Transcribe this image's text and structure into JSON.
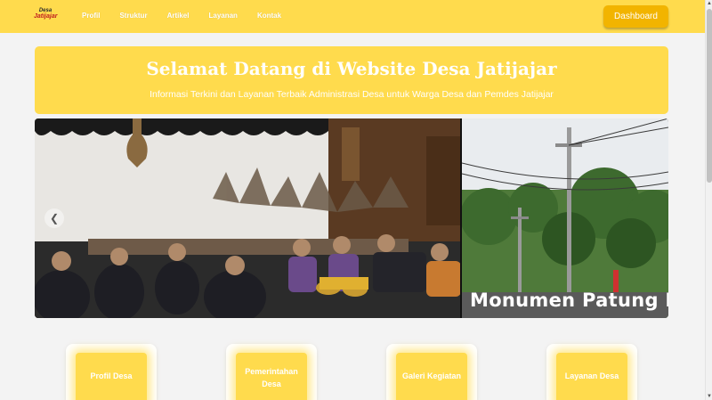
{
  "navbar": {
    "logo": {
      "line1": "Desa",
      "line2": "Jatijajar"
    },
    "links": [
      "Profil",
      "Struktur",
      "Artikel",
      "Layanan",
      "Kontak"
    ],
    "dashboard_label": "Dashboard"
  },
  "hero": {
    "title": "Selamat Datang di Website Desa Jatijajar",
    "subtitle": "Informasi Terkini dan Layanan Terbaik Administrasi Desa untuk Warga Desa dan Pemdes Jatijajar"
  },
  "carousel": {
    "caption": "Monumen Patung Pun",
    "prev_icon": "chevron-left-icon"
  },
  "cards": [
    "Profil Desa",
    "Pemerintahan Desa",
    "Galeri Kegiatan",
    "Layanan Desa"
  ],
  "colors": {
    "primary": "#ffdb4d",
    "button": "#f2b400",
    "background": "#f3f3f3"
  }
}
